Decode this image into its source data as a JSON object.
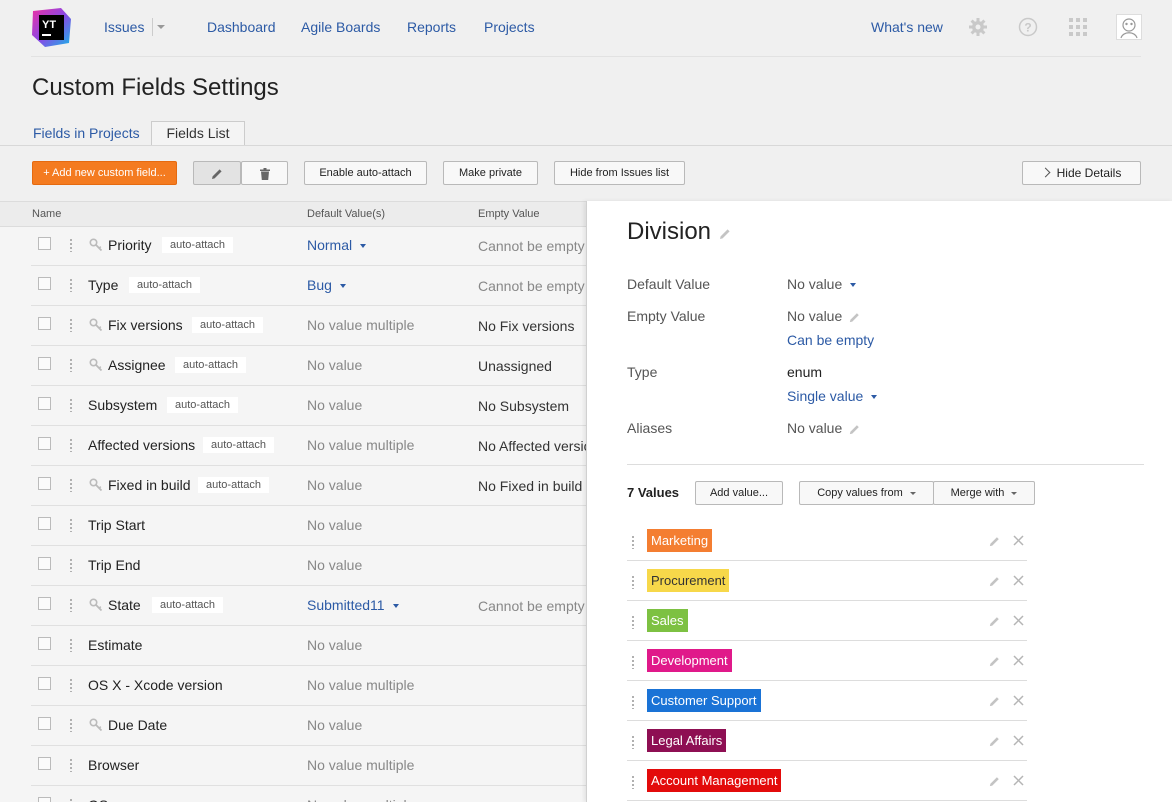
{
  "header": {
    "logo_text": "YT",
    "nav": {
      "issues": "Issues",
      "dashboard": "Dashboard",
      "agile_boards": "Agile Boards",
      "reports": "Reports",
      "projects": "Projects",
      "whats_new": "What's new"
    },
    "icons": [
      "gear-icon",
      "help-icon",
      "apps-grid-icon",
      "user-avatar"
    ]
  },
  "page": {
    "title": "Custom Fields Settings",
    "tabs": [
      "Fields in Projects",
      "Fields List"
    ],
    "active_tab": "Fields List"
  },
  "toolbar": {
    "add_label": "+ Add new custom field...",
    "enable_auto_attach": "Enable auto-attach",
    "make_private": "Make private",
    "hide_from_issues": "Hide from Issues list",
    "hide_details": "Hide Details",
    "accent_color": "#f47b20"
  },
  "table": {
    "columns": {
      "name": "Name",
      "default_value": "Default Value(s)",
      "empty_value": "Empty Value"
    },
    "rows": [
      {
        "name": "Priority",
        "key": true,
        "auto_attach": "auto-attach",
        "default": "Normal",
        "default_dropdown": true,
        "empty": "Cannot be empty",
        "empty_muted": true
      },
      {
        "name": "Type",
        "key": false,
        "auto_attach": "auto-attach",
        "default": "Bug",
        "default_dropdown": true,
        "empty": "Cannot be empty",
        "empty_muted": true
      },
      {
        "name": "Fix versions",
        "key": true,
        "auto_attach": "auto-attach",
        "default": "No value multiple",
        "default_dropdown": false,
        "empty": "No Fix versions",
        "empty_muted": false
      },
      {
        "name": "Assignee",
        "key": true,
        "auto_attach": "auto-attach",
        "default": "No value",
        "default_dropdown": false,
        "empty": "Unassigned",
        "empty_muted": false
      },
      {
        "name": "Subsystem",
        "key": false,
        "auto_attach": "auto-attach",
        "default": "No value",
        "default_dropdown": false,
        "empty": "No Subsystem",
        "empty_muted": false
      },
      {
        "name": "Affected versions",
        "key": false,
        "auto_attach": "auto-attach",
        "default": "No value multiple",
        "default_dropdown": false,
        "empty": "No Affected versio",
        "empty_muted": false
      },
      {
        "name": "Fixed in build",
        "key": true,
        "auto_attach": "auto-attach",
        "default": "No value",
        "default_dropdown": false,
        "empty": "No Fixed in build",
        "empty_muted": false
      },
      {
        "name": "Trip Start",
        "key": false,
        "auto_attach": "",
        "default": "No value",
        "default_dropdown": false,
        "empty": "",
        "empty_muted": false
      },
      {
        "name": "Trip End",
        "key": false,
        "auto_attach": "",
        "default": "No value",
        "default_dropdown": false,
        "empty": "",
        "empty_muted": false
      },
      {
        "name": "State",
        "key": true,
        "auto_attach": "auto-attach",
        "default": "Submitted11",
        "default_dropdown": true,
        "empty": "Cannot be empty",
        "empty_muted": true
      },
      {
        "name": "Estimate",
        "key": false,
        "auto_attach": "",
        "default": "No value",
        "default_dropdown": false,
        "empty": "",
        "empty_muted": false
      },
      {
        "name": "OS X - Xcode version",
        "key": false,
        "auto_attach": "",
        "default": "No value multiple",
        "default_dropdown": false,
        "empty": "",
        "empty_muted": false
      },
      {
        "name": "Due Date",
        "key": true,
        "auto_attach": "",
        "default": "No value",
        "default_dropdown": false,
        "empty": "",
        "empty_muted": false
      },
      {
        "name": "Browser",
        "key": false,
        "auto_attach": "",
        "default": "No value multiple",
        "default_dropdown": false,
        "empty": "",
        "empty_muted": false
      },
      {
        "name": "OS",
        "key": false,
        "auto_attach": "",
        "default": "No value multiple",
        "default_dropdown": false,
        "empty": "",
        "empty_muted": false
      }
    ]
  },
  "details": {
    "title": "Division",
    "default_value_label": "Default Value",
    "default_value": "No value",
    "empty_value_label": "Empty Value",
    "empty_value": "No value",
    "can_be_empty": "Can be empty",
    "type_label": "Type",
    "type_value": "enum",
    "cardinality": "Single value",
    "aliases_label": "Aliases",
    "aliases_value": "No value",
    "values_count": "7 Values",
    "add_value": "Add value...",
    "copy_values_from": "Copy values from",
    "merge_with": "Merge with",
    "values": [
      {
        "label": "Marketing",
        "bg": "#f47e31",
        "fg": "#ffffff"
      },
      {
        "label": "Procurement",
        "bg": "#f7d84a",
        "fg": "#333333"
      },
      {
        "label": "Sales",
        "bg": "#7dc142",
        "fg": "#ffffff"
      },
      {
        "label": "Development",
        "bg": "#e0198a",
        "fg": "#ffffff"
      },
      {
        "label": "Customer Support",
        "bg": "#1a73d6",
        "fg": "#ffffff"
      },
      {
        "label": "Legal Affairs",
        "bg": "#8e0f53",
        "fg": "#ffffff"
      },
      {
        "label": "Account Management",
        "bg": "#e30b0b",
        "fg": "#ffffff"
      }
    ]
  }
}
